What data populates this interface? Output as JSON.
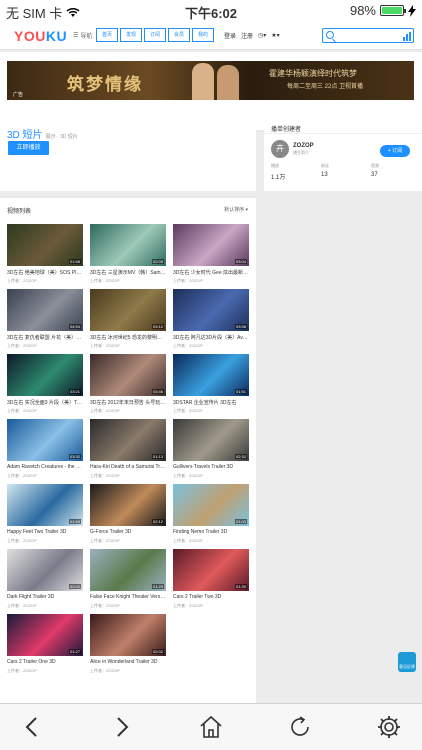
{
  "status": {
    "carrier": "无 SIM 卡",
    "time": "下午6:02",
    "battery": "98%",
    "battery_level": 0.98
  },
  "nav": {
    "logo_a": "YOU",
    "logo_b": "KU",
    "menu": "导航",
    "tabs": [
      "首页",
      "发现",
      "订阅",
      "会员",
      "我的"
    ],
    "login": "登录",
    "register": "注册"
  },
  "ad": {
    "headline": "筑梦情缘",
    "slogan": "霍建华杨颖演绎时代筑梦",
    "sub": "每周二至周三 22点 卫视首播",
    "tag": "广告"
  },
  "intro": {
    "title": "3D 短片",
    "meta": "展示 · 3D 短片",
    "play": "立即播放"
  },
  "creator": {
    "header": "播单创建者",
    "avatar_char": "卉",
    "name": "ZOZOP",
    "sub": "播主简介",
    "subscribe": "+ 订阅",
    "stats": [
      {
        "label": "播放",
        "value": "1.1万"
      },
      {
        "label": "粉丝",
        "value": "13"
      },
      {
        "label": "视频",
        "value": "37"
      }
    ]
  },
  "list": {
    "header": "视频列表",
    "sort": "默认排序",
    "items": [
      {
        "title": "3D左右 绝美地球（美）SOS Pla…",
        "uploader": "上传者：ZOZOP",
        "duration": "01:58",
        "c1": "#2d3a1e",
        "c2": "#6b5a3a"
      },
      {
        "title": "3D左右 三星演示MV（韩）Sam…",
        "uploader": "上传者：ZOZOP",
        "duration": "02:05",
        "c1": "#2f6b5e",
        "c2": "#9ec9b8"
      },
      {
        "title": "3D左右 少女时代 Gee 炫出最新款（…",
        "uploader": "上传者：ZOZOP",
        "duration": "03:04",
        "c1": "#5a3a5e",
        "c2": "#c9a6c4"
      },
      {
        "title": "3D左右 复仇者联盟 片花（美）T…",
        "uploader": "上传者：ZOZOP",
        "duration": "04:54",
        "c1": "#3a4150",
        "c2": "#8a8f99"
      },
      {
        "title": "3D左右 冰河世纪5 恐龙的黎明…",
        "uploader": "上传者：ZOZOP",
        "duration": "03:12",
        "c1": "#4a3a1e",
        "c2": "#8f7a4a"
      },
      {
        "title": "3D左右 阿凡达3D片段（美）Ava…",
        "uploader": "上传者：ZOZOP",
        "duration": "03:58",
        "c1": "#1e2e5a",
        "c2": "#4a6ab0"
      },
      {
        "title": "3D左右 实况全面3 片段（美）Tr…",
        "uploader": "上传者：ZOZOP",
        "duration": "03:21",
        "c1": "#0e1a2a",
        "c2": "#2e8a6e"
      },
      {
        "title": "3D左右 2012年末日预告 头号玩…",
        "uploader": "上传者：ZOZOP",
        "duration": "03:46",
        "c1": "#3a2a2a",
        "c2": "#b08a7a"
      },
      {
        "title": "3DSTAR 企业宣传片 3D左右",
        "uploader": "上传者：ZOZOP",
        "duration": "01:51",
        "c1": "#0a2a5a",
        "c2": "#3aa0e0"
      },
      {
        "title": "Adam Ravetch Creatures - the P…",
        "uploader": "上传者：ZOZOP",
        "duration": "03:32",
        "c1": "#1a5a9a",
        "c2": "#8ac0e6"
      },
      {
        "title": "Hara-Kiri Death of a Samurai Tr…",
        "uploader": "上传者：ZOZOP",
        "duration": "01:13",
        "c1": "#2a2a2a",
        "c2": "#8a7a6a"
      },
      {
        "title": "Gullivers Travels Trailer 3D",
        "uploader": "上传者：ZOZOP",
        "duration": "02:32",
        "c1": "#3a3a3a",
        "c2": "#a09a8a"
      },
      {
        "title": "Happy Feet Two Trailer 3D",
        "uploader": "上传者：ZOZOP",
        "duration": "01:59",
        "c1": "#d0e6f0",
        "c2": "#2a6aa0"
      },
      {
        "title": "G-Force Trailer 3D",
        "uploader": "上传者：ZOZOP",
        "duration": "02:12",
        "c1": "#1a1a1a",
        "c2": "#c08a5a"
      },
      {
        "title": "Finding Nemo Trailer 3D",
        "uploader": "上传者：ZOZOP",
        "duration": "01:03",
        "c1": "#7ac0e0",
        "c2": "#c0a070"
      },
      {
        "title": "Dark Flight Trailer 3D",
        "uploader": "上传者：ZOZOP",
        "duration": "02:02",
        "c1": "#e0e0e0",
        "c2": "#7a7a8a"
      },
      {
        "title": "False Face Knight Theater Versi…",
        "uploader": "上传者：ZOZOP",
        "duration": "01:29",
        "c1": "#9ab0c0",
        "c2": "#5a7a4a"
      },
      {
        "title": "Cars 2 Trailer Two 3D",
        "uploader": "上传者：ZOZOP",
        "duration": "01:30",
        "c1": "#5a1a2a",
        "c2": "#e05a5a"
      },
      {
        "title": "Cars 2 Trailer One 3D",
        "uploader": "上传者：ZOZOP",
        "duration": "01:27",
        "c1": "#1a1a3a",
        "c2": "#e03a6a"
      },
      {
        "title": "Alice in Wonderland Trailer 3D",
        "uploader": "上传者：ZOZOP",
        "duration": "02:02",
        "c1": "#3a1a1a",
        "c2": "#c0806a"
      }
    ]
  },
  "float_label": "意见反馈",
  "colors": {
    "accent": "#1e90ff",
    "logo_red": "#ff4d4f"
  }
}
